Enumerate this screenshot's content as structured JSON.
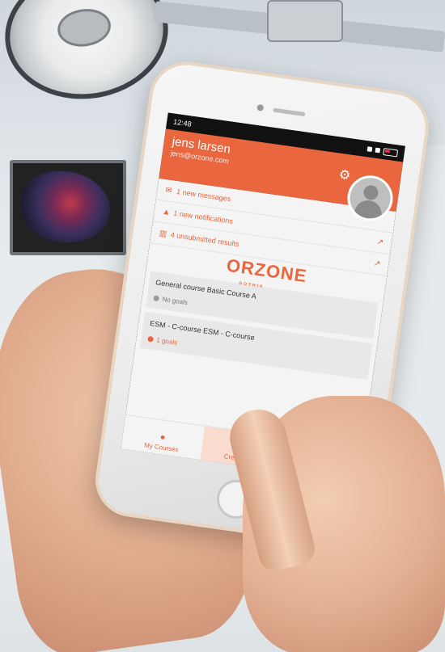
{
  "status_bar": {
    "time": "12:48"
  },
  "user": {
    "name": "jens larsen",
    "email": "jens@orzone.com"
  },
  "menu": [
    {
      "icon": "envelope-icon",
      "glyph": "✉",
      "label": "1 new messages",
      "ext": ""
    },
    {
      "icon": "warning-icon",
      "glyph": "▲",
      "label": "1 new notifications",
      "ext": "↗"
    },
    {
      "icon": "chart-icon",
      "glyph": "▥",
      "label": "4 unsubmitted results",
      "ext": "↗"
    }
  ],
  "logo": {
    "text": "ORZONE",
    "sub": "GOTHIA"
  },
  "courses": [
    {
      "title": "General course Basic Course A",
      "goals": "No goals"
    },
    {
      "title": "ESM - C-course ESM - C-course",
      "goals": "1 goals"
    }
  ],
  "tabs": {
    "my_courses": "My Courses",
    "create_new": "Create new"
  },
  "colors": {
    "accent": "#e9663e"
  }
}
